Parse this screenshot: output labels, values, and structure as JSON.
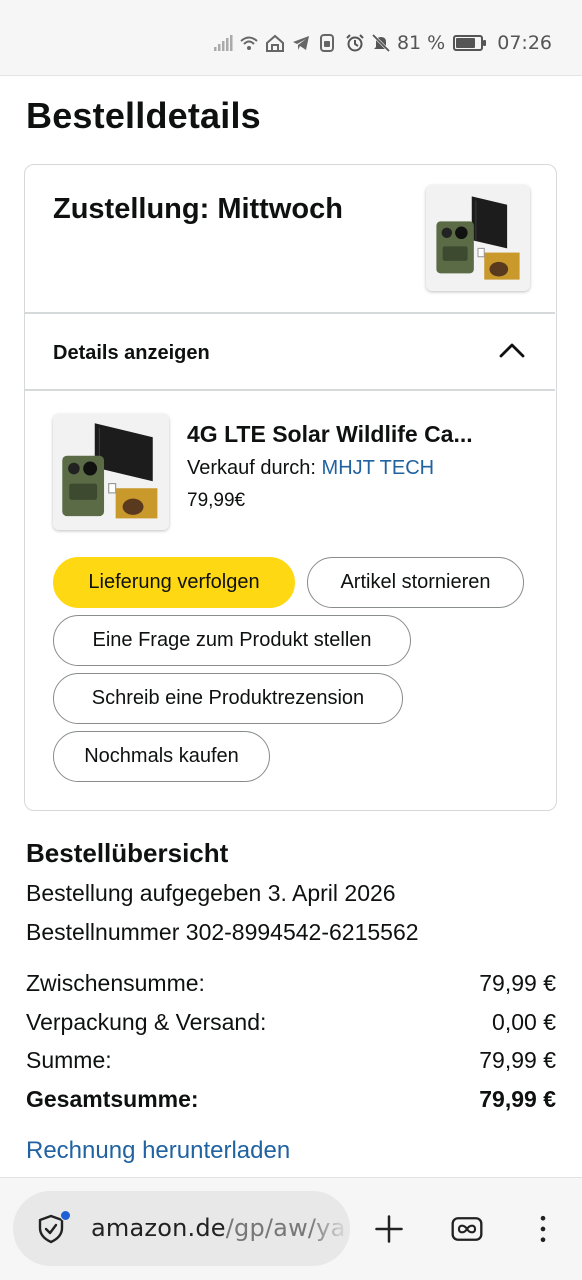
{
  "status_bar": {
    "battery_percent": "81 %",
    "battery_level": 0.81,
    "time": "07:26",
    "icons_left": [
      "signal-icon",
      "wifi-icon",
      "home-icon",
      "telegram-icon",
      "sim-icon"
    ],
    "icons_right": [
      "alarm-icon",
      "mute-icon",
      "battery-icon"
    ]
  },
  "page": {
    "title": "Bestelldetails"
  },
  "shipment": {
    "delivery": "Zustellung: Mittwoch",
    "details_toggle": "Details anzeigen",
    "expanded": true
  },
  "item": {
    "title": "4G LTE Solar Wildlife Ca...",
    "seller_prefix": "Verkauf durch:",
    "seller_name": "MHJT TECH",
    "price": "79,99€"
  },
  "actions": {
    "track": "Lieferung verfolgen",
    "cancel": "Artikel stornieren",
    "ask": "Eine Frage zum Produkt stellen",
    "review": "Schreib eine Produktrezension",
    "buy_again": "Nochmals kaufen"
  },
  "summary": {
    "title": "Bestellübersicht",
    "placed": "Bestellung aufgegeben 3. April 2026",
    "order_number": "Bestellnummer 302-8994542-6215562",
    "rows": [
      {
        "label": "Zwischensumme:",
        "value": "79,99 €"
      },
      {
        "label": "Verpackung & Versand:",
        "value": "0,00 €"
      },
      {
        "label": "Summe:",
        "value": "79,99 €"
      },
      {
        "label": "Gesamtsumme:",
        "value": "79,99 €"
      }
    ],
    "invoice_link": "Rechnung herunterladen"
  },
  "browser": {
    "url_domain": "amazon.de",
    "url_path": "/gp/aw/ya",
    "accent": "#1f5fd6"
  },
  "colors": {
    "primary_button": "#ffd814",
    "link": "#2162a1",
    "border": "#d5d9d9"
  }
}
